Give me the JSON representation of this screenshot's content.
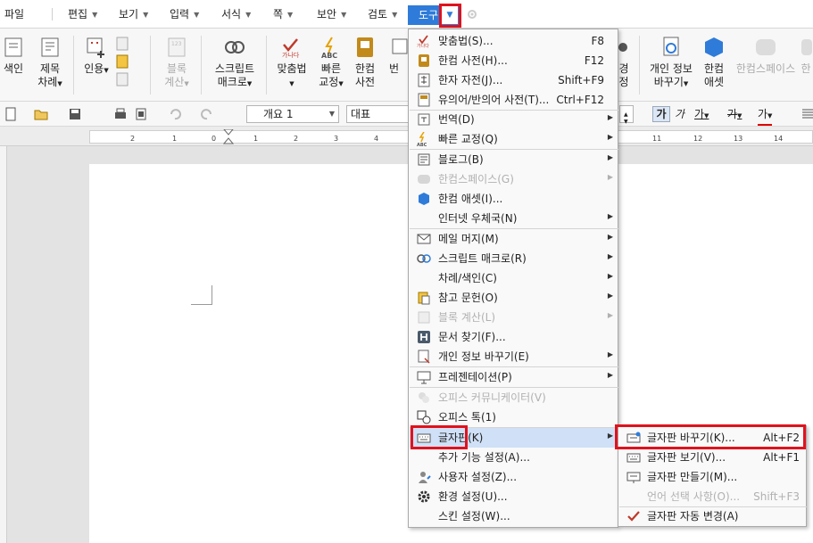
{
  "menubar": {
    "items": [
      {
        "label": "파일",
        "caret": false
      },
      {
        "label": "편집",
        "caret": true
      },
      {
        "label": "보기",
        "caret": true
      },
      {
        "label": "입력",
        "caret": true
      },
      {
        "label": "서식",
        "caret": true
      },
      {
        "label": "쪽",
        "caret": true
      },
      {
        "label": "보안",
        "caret": true
      },
      {
        "label": "검토",
        "caret": true
      }
    ],
    "active": "도구"
  },
  "ribbon": {
    "items": [
      {
        "label": "색인",
        "label2": ""
      },
      {
        "label": "제목",
        "label2": "차례"
      },
      {
        "label": "인용",
        "label2": ""
      },
      {
        "label": "블록",
        "label2": "계산"
      },
      {
        "label": "스크립트",
        "label2": "매크로"
      },
      {
        "label": "맞춤법",
        "label2": ""
      },
      {
        "label": "빠른",
        "label2": "교정"
      },
      {
        "label": "한컴",
        "label2": "사전"
      },
      {
        "label": "번",
        "label2": ""
      },
      {
        "label": "경",
        "label2": "정"
      },
      {
        "label": "개인 정보",
        "label2": "바꾸기"
      },
      {
        "label": "한컴",
        "label2": "애셋"
      },
      {
        "label": "한컴스페이스",
        "label2": ""
      },
      {
        "label": "한",
        "label2": ""
      }
    ]
  },
  "format": {
    "style": "개요 1",
    "font_face": "대표",
    "bold_glyph": "가",
    "italic_glyph": "가",
    "underline_glyph": "가",
    "strike_glyph": "가",
    "color_glyph": "가"
  },
  "ruler": {
    "numbers": [
      "2",
      "1",
      "0",
      "1",
      "2",
      "3",
      "4",
      "11",
      "12",
      "13",
      "14"
    ]
  },
  "tools_menu": {
    "items": [
      {
        "label": "맞춤법(S)...",
        "shortcut": "F8",
        "submenu": false,
        "disabled": false,
        "icon": "spellcheck-icon"
      },
      {
        "label": "한컴 사전(H)...",
        "shortcut": "F12",
        "submenu": false,
        "disabled": false,
        "icon": "dictionary-icon"
      },
      {
        "label": "한자 자전(J)...",
        "shortcut": "Shift+F9",
        "submenu": false,
        "disabled": false,
        "icon": "hanja-icon"
      },
      {
        "label": "유의어/반의어 사전(T)...",
        "shortcut": "Ctrl+F12",
        "submenu": false,
        "disabled": false,
        "icon": "thesaurus-icon"
      },
      {
        "label": "번역(D)",
        "shortcut": "",
        "submenu": true,
        "disabled": false,
        "icon": "translate-icon"
      },
      {
        "label": "빠른 교정(Q)",
        "shortcut": "",
        "submenu": true,
        "disabled": false,
        "icon": "quick-correct-icon"
      },
      {
        "label": "블로그(B)",
        "shortcut": "",
        "submenu": true,
        "disabled": false,
        "icon": "blog-icon"
      },
      {
        "label": "한컴스페이스(G)",
        "shortcut": "",
        "submenu": true,
        "disabled": true,
        "icon": "hancom-space-icon"
      },
      {
        "label": "한컴 애셋(I)...",
        "shortcut": "",
        "submenu": false,
        "disabled": false,
        "icon": "hancom-asset-icon"
      },
      {
        "label": "인터넷 우체국(N)",
        "shortcut": "",
        "submenu": true,
        "disabled": false,
        "icon": ""
      },
      {
        "label": "메일 머지(M)",
        "shortcut": "",
        "submenu": true,
        "disabled": false,
        "icon": "mail-icon"
      },
      {
        "label": "스크립트 매크로(R)",
        "shortcut": "",
        "submenu": true,
        "disabled": false,
        "icon": "macro-icon"
      },
      {
        "label": "차례/색인(C)",
        "shortcut": "",
        "submenu": true,
        "disabled": false,
        "icon": ""
      },
      {
        "label": "참고 문헌(O)",
        "shortcut": "",
        "submenu": true,
        "disabled": false,
        "icon": "bibliography-icon"
      },
      {
        "label": "블록 계산(L)",
        "shortcut": "",
        "submenu": true,
        "disabled": true,
        "icon": "block-calc-icon"
      },
      {
        "label": "문서 찾기(F)...",
        "shortcut": "",
        "submenu": false,
        "disabled": false,
        "icon": "find-document-icon"
      },
      {
        "label": "개인 정보 바꾸기(E)",
        "shortcut": "",
        "submenu": true,
        "disabled": false,
        "icon": "privacy-icon"
      },
      {
        "label": "프레젠테이션(P)",
        "shortcut": "",
        "submenu": true,
        "disabled": false,
        "icon": "presentation-icon"
      },
      {
        "label": "오피스 커뮤니케이터(V)",
        "shortcut": "",
        "submenu": false,
        "disabled": true,
        "icon": "communicator-icon"
      },
      {
        "label": "오피스 톡(1)",
        "shortcut": "",
        "submenu": false,
        "disabled": false,
        "icon": "office-talk-icon"
      },
      {
        "label": "글자판(K)",
        "shortcut": "",
        "submenu": true,
        "disabled": false,
        "icon": "keyboard-icon"
      },
      {
        "label": "추가 기능 설정(A)...",
        "shortcut": "",
        "submenu": false,
        "disabled": false,
        "icon": ""
      },
      {
        "label": "사용자 설정(Z)...",
        "shortcut": "",
        "submenu": false,
        "disabled": false,
        "icon": "user-settings-icon"
      },
      {
        "label": "환경 설정(U)...",
        "shortcut": "",
        "submenu": false,
        "disabled": false,
        "icon": "gear-icon"
      },
      {
        "label": "스킨 설정(W)...",
        "shortcut": "",
        "submenu": false,
        "disabled": false,
        "icon": ""
      }
    ]
  },
  "keyboard_submenu": {
    "items": [
      {
        "label": "글자판 바꾸기(K)...",
        "shortcut": "Alt+F2",
        "disabled": false,
        "checked": false
      },
      {
        "label": "글자판 보기(V)...",
        "shortcut": "Alt+F1",
        "disabled": false,
        "checked": false
      },
      {
        "label": "글자판 만들기(M)...",
        "shortcut": "",
        "disabled": false,
        "checked": false
      },
      {
        "label": "언어 선택 사항(O)...",
        "shortcut": "Shift+F3",
        "disabled": true,
        "checked": false
      },
      {
        "label": "글자판 자동 변경(A)",
        "shortcut": "",
        "disabled": false,
        "checked": true
      }
    ]
  },
  "colors": {
    "accent": "#2f7bd9",
    "highlight": "#e0121d",
    "selection": "#cfe0f7"
  }
}
